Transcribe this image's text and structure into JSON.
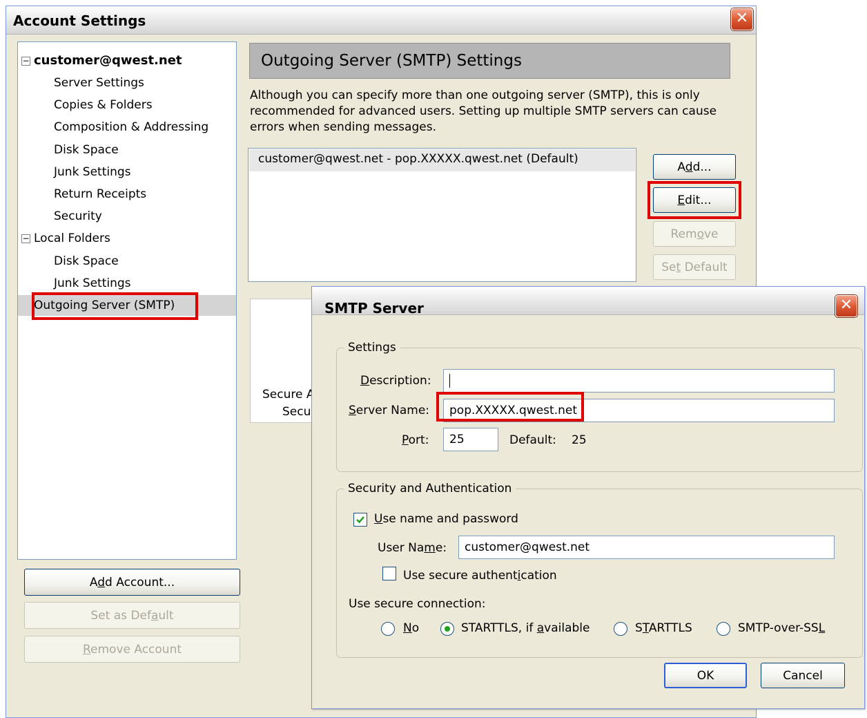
{
  "account_window": {
    "title": "Account Settings",
    "close_label": "✕",
    "tree": {
      "account": "customer@qwest.net",
      "account_items": [
        "Server Settings",
        "Copies & Folders",
        "Composition & Addressing",
        "Disk Space",
        "Junk Settings",
        "Return Receipts",
        "Security"
      ],
      "local_folders": "Local Folders",
      "local_items": [
        "Disk Space",
        "Junk Settings"
      ],
      "outgoing": "Outgoing Server (SMTP)",
      "expander": "−"
    },
    "buttons": {
      "add_account_pre": "A",
      "add_account_u": "d",
      "add_account_post": "d Account...",
      "set_default_pre": "Set as Def",
      "set_default_u": "a",
      "set_default_post": "ult",
      "remove_account_pre": "",
      "remove_account_u": "R",
      "remove_account_post": "emove Account"
    },
    "panel": {
      "title": "Outgoing Server (SMTP) Settings",
      "description": "Although you can specify more than one outgoing server (SMTP), this is only recommended for advanced users. Setting up multiple SMTP servers can cause errors when sending messages.",
      "server_entry": "customer@qwest.net - pop.XXXXX.qwest.net (Default)",
      "add_pre": "A",
      "add_u": "d",
      "add_post": "d...",
      "edit_pre": "",
      "edit_u": "E",
      "edit_post": "dit...",
      "remove_pre": "Rem",
      "remove_u": "o",
      "remove_post": "ve",
      "setdef_pre": "Se",
      "setdef_u": "t",
      "setdef_post": " Default",
      "details_line1": "Secure A",
      "details_line2": "Secur"
    }
  },
  "smtp_dialog": {
    "title": "SMTP Server",
    "close_label": "✕",
    "settings_group": "Settings",
    "description_pre": "",
    "description_u": "D",
    "description_post": "escription:",
    "description_value": "",
    "server_name_pre": "",
    "server_name_u": "S",
    "server_name_post": "erver Name:",
    "server_name_value": "pop.XXXXX.qwest.net",
    "port_pre": "",
    "port_u": "P",
    "port_post": "ort:",
    "port_value": "25",
    "default_label": "Default:",
    "default_value": "25",
    "security_group": "Security and Authentication",
    "use_name_pre": "",
    "use_name_u": "U",
    "use_name_post": "se name and password",
    "use_name_checked": true,
    "user_name_pre": "User Na",
    "user_name_u": "m",
    "user_name_post": "e:",
    "user_name_value": "customer@qwest.net",
    "secure_auth_pre": "Use secure authent",
    "secure_auth_u": "i",
    "secure_auth_post": "cation",
    "secure_auth_checked": false,
    "secure_conn_label": "Use secure connection:",
    "radio_no_pre": "",
    "radio_no_u": "N",
    "radio_no_post": "o",
    "radio_starttls_avail_pre": "STARTTLS, if ",
    "radio_starttls_avail_u": "a",
    "radio_starttls_avail_post": "vailable",
    "radio_starttls_pre": "S",
    "radio_starttls_u": "T",
    "radio_starttls_post": "ARTTLS",
    "radio_ssl_pre": "SMTP-over-SS",
    "radio_ssl_u": "L",
    "radio_ssl_post": "",
    "selected_connection": "STARTTLS, if available",
    "ok_label": "OK",
    "cancel_label": "Cancel"
  },
  "colors": {
    "highlight_box": "#e10000",
    "window_bg": "#ece9d8",
    "panel_header_bg": "#b5b5b5",
    "check_mark": "#21a121"
  }
}
